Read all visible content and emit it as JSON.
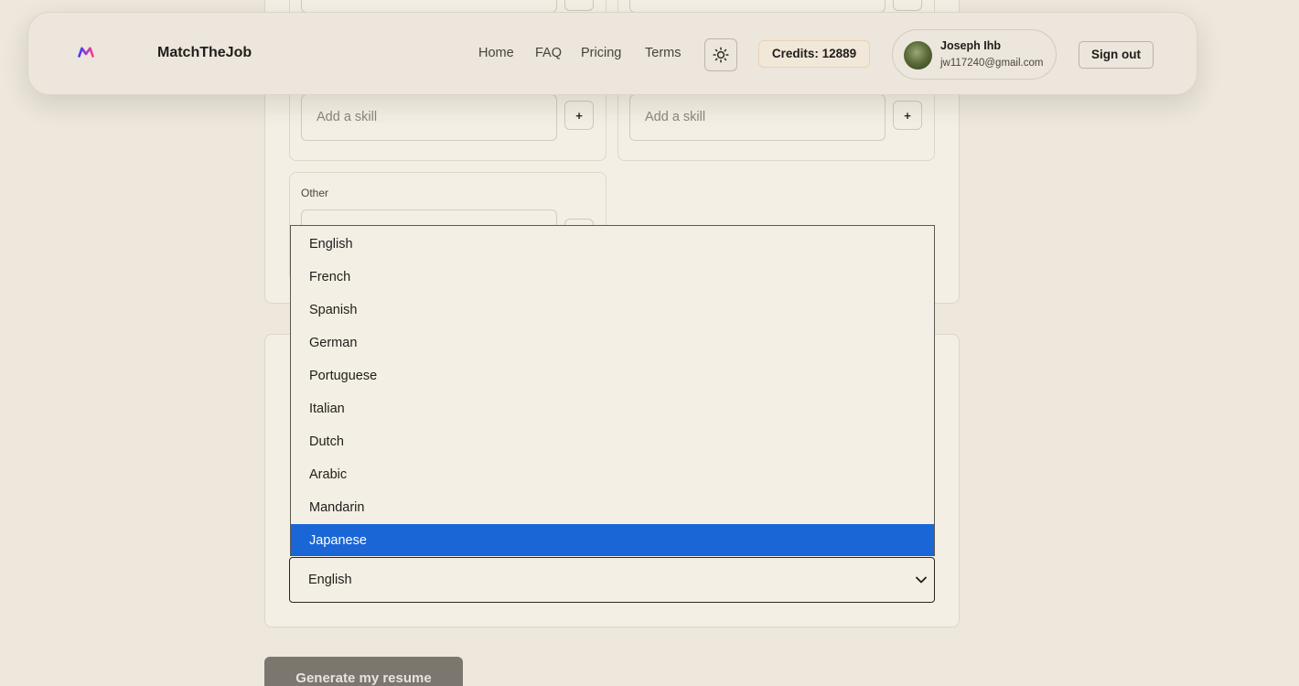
{
  "header": {
    "brand": "MatchTheJob",
    "nav": [
      "Home",
      "FAQ",
      "Pricing",
      "Terms"
    ],
    "credits_label": "Credits: 12889",
    "user": {
      "name": "Joseph Ihb",
      "email": "jw117240@gmail.com"
    },
    "sign_out": "Sign out",
    "theme_icon": "sun-icon",
    "logo_icon": "m-logo-icon",
    "accent_colors": {
      "logo_blue": "#3b3bff",
      "logo_pink": "#ff3b8f"
    }
  },
  "skills": {
    "placeholder": "Add a skill",
    "add_button": "+",
    "other_label": "Other"
  },
  "language": {
    "selected": "English",
    "options": [
      "English",
      "French",
      "Spanish",
      "German",
      "Portuguese",
      "Italian",
      "Dutch",
      "Arabic",
      "Mandarin",
      "Japanese"
    ],
    "highlighted": "Japanese",
    "highlight_color": "#1a66d6"
  },
  "generate_button": "Generate my resume"
}
